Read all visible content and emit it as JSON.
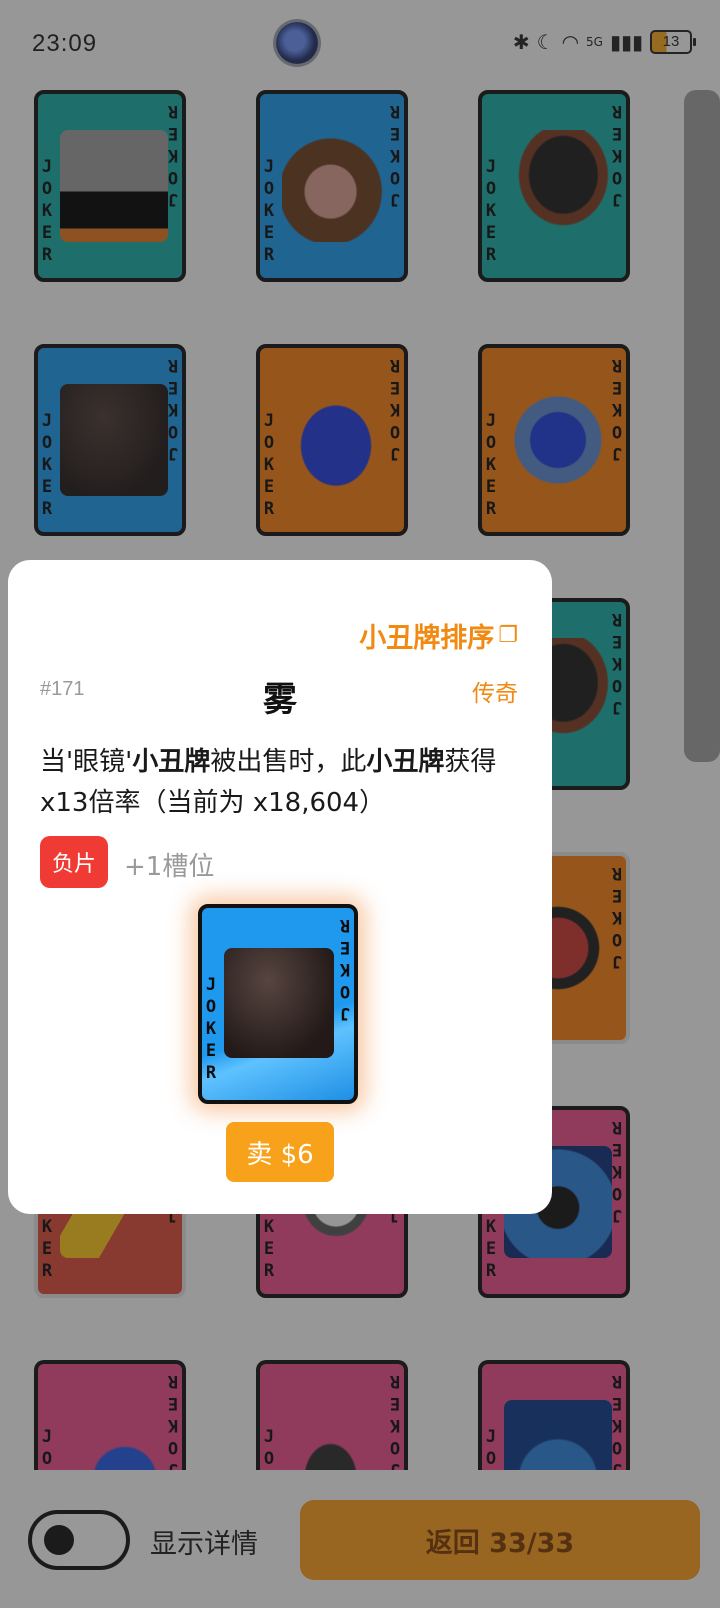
{
  "status_bar": {
    "time": "23:09",
    "icons": [
      "bluetooth-icon",
      "moon-icon",
      "wifi-icon",
      "5g-icon",
      "signal-icon"
    ],
    "battery": "13"
  },
  "cards_grid": [
    {
      "art": "floppy-disk-art",
      "color": "teal",
      "text": "JOKER"
    },
    {
      "art": "tv-art",
      "color": "blue",
      "text": "JOKER"
    },
    {
      "art": "satellite-dish-art",
      "color": "teal",
      "text": "JOKER"
    },
    {
      "art": "fog-art",
      "color": "blue",
      "text": "JOKER"
    },
    {
      "art": "sponge-art",
      "color": "orange",
      "text": "JOKER"
    },
    {
      "art": "bear-art",
      "color": "orange",
      "text": "JOKER"
    },
    {
      "art": "satellite-dish-art",
      "color": "teal",
      "text": "JOKER"
    },
    {
      "art": "oni-mask-art",
      "color": "orange",
      "text": "JOKER"
    },
    {
      "art": "water-gun-art",
      "color": "red",
      "text": "JOKER"
    },
    {
      "art": "hole-art",
      "color": "pink",
      "text": "JOKER"
    },
    {
      "art": "sunset-art",
      "color": "pink",
      "text": "JOKER"
    },
    {
      "art": "star-art",
      "color": "pink",
      "text": "JOKER"
    },
    {
      "art": "hand-art",
      "color": "pink",
      "text": "JOKER"
    },
    {
      "art": "blue-burst-art",
      "color": "pink",
      "text": "JOKER"
    }
  ],
  "modal": {
    "sort_label": "小丑牌排序",
    "card_number": "#171",
    "card_name": "雾",
    "rarity": "传奇",
    "desc": {
      "p1": "当'眼镜'",
      "b1": "小丑牌",
      "p2": "被出售时，此",
      "b2": "小丑牌",
      "p3": "获得 x13倍率（当前为 x18,604）"
    },
    "badge": "负片",
    "slot_note": "+1槽位",
    "preview_text": "JOKER",
    "sell_label": "卖 $6"
  },
  "bottom_bar": {
    "toggle_label": "显示详情",
    "return_label": "返回 33/33"
  },
  "colors": {
    "accent": "#f59a1d",
    "negative_badge": "#ef3b34"
  }
}
